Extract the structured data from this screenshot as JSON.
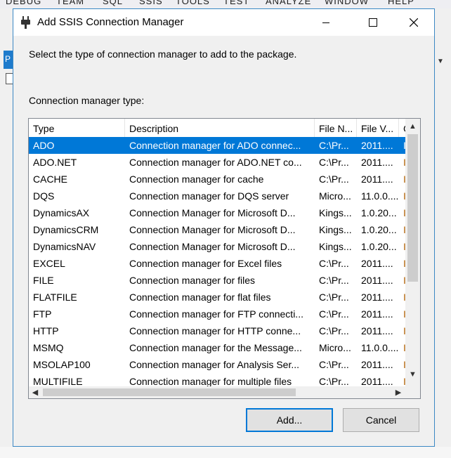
{
  "background": {
    "menu_fragments": [
      "DEBUG",
      "TEAM",
      "SQL",
      "SSIS",
      "TOOLS",
      "TEST",
      "ANALYZE",
      "WINDOW",
      "HELP"
    ],
    "tab_letter": "P",
    "dropdown_glyph": "▼"
  },
  "dialog": {
    "title": "Add SSIS Connection Manager",
    "prompt": "Select the type of connection manager to add to the package.",
    "list_label": "Connection manager type:",
    "add_label": "Add...",
    "cancel_label": "Cancel"
  },
  "columns": [
    "Type",
    "Description",
    "File N...",
    "File V...",
    "C"
  ],
  "rows": [
    {
      "type": "ADO",
      "description": "Connection manager for ADO connec...",
      "file_name": "C:\\Pr...",
      "file_version": "2011....",
      "extra": "I",
      "selected": true
    },
    {
      "type": "ADO.NET",
      "description": "Connection manager for ADO.NET co...",
      "file_name": "C:\\Pr...",
      "file_version": "2011....",
      "extra": "I"
    },
    {
      "type": "CACHE",
      "description": "Connection manager for cache",
      "file_name": "C:\\Pr...",
      "file_version": "2011....",
      "extra": "I"
    },
    {
      "type": "DQS",
      "description": "Connection manager for DQS server",
      "file_name": "Micro...",
      "file_version": "11.0.0....",
      "extra": "I"
    },
    {
      "type": "DynamicsAX",
      "description": "Connection Manager for Microsoft D...",
      "file_name": "Kings...",
      "file_version": "1.0.20...",
      "extra": "I"
    },
    {
      "type": "DynamicsCRM",
      "description": "Connection Manager for Microsoft D...",
      "file_name": "Kings...",
      "file_version": "1.0.20...",
      "extra": "I"
    },
    {
      "type": "DynamicsNAV",
      "description": "Connection Manager for Microsoft D...",
      "file_name": "Kings...",
      "file_version": "1.0.20...",
      "extra": "I"
    },
    {
      "type": "EXCEL",
      "description": "Connection manager for Excel files",
      "file_name": "C:\\Pr...",
      "file_version": "2011....",
      "extra": "I"
    },
    {
      "type": "FILE",
      "description": "Connection manager for files",
      "file_name": "C:\\Pr...",
      "file_version": "2011....",
      "extra": "I"
    },
    {
      "type": "FLATFILE",
      "description": "Connection manager for flat files",
      "file_name": "C:\\Pr...",
      "file_version": "2011....",
      "extra": "I"
    },
    {
      "type": "FTP",
      "description": "Connection manager for FTP connecti...",
      "file_name": "C:\\Pr...",
      "file_version": "2011....",
      "extra": "I"
    },
    {
      "type": "HTTP",
      "description": "Connection manager for HTTP conne...",
      "file_name": "C:\\Pr...",
      "file_version": "2011....",
      "extra": "I"
    },
    {
      "type": "MSMQ",
      "description": "Connection manager for the Message...",
      "file_name": "Micro...",
      "file_version": "11.0.0....",
      "extra": "I"
    },
    {
      "type": "MSOLAP100",
      "description": "Connection manager for Analysis Ser...",
      "file_name": "C:\\Pr...",
      "file_version": "2011....",
      "extra": "I"
    },
    {
      "type": "MULTIFILE",
      "description": "Connection manager for multiple files",
      "file_name": "C:\\Pr...",
      "file_version": "2011....",
      "extra": "I"
    }
  ],
  "icons": {
    "title": "ssis-plug-icon",
    "minimize": "minimize-icon",
    "maximize": "maximize-icon",
    "close": "close-icon",
    "scroll_up": "▲",
    "scroll_down": "▼",
    "scroll_left": "◀",
    "scroll_right": "▶"
  },
  "colors": {
    "selection": "#0078d7",
    "window_border": "#3b88c4",
    "default_button_border": "#0078d7"
  }
}
